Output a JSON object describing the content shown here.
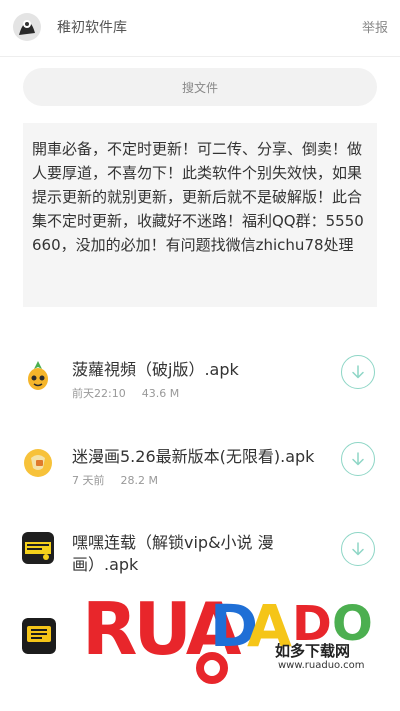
{
  "header": {
    "title": "稚初软件库",
    "report_label": "举报"
  },
  "search": {
    "placeholder": "搜文件"
  },
  "notice": {
    "text": "開車必备，不定时更新！可二传、分享、倒卖！做人要厚道，不喜勿下！此类软件个别失效快，如果提示更新的就别更新，更新后就不是破解版！此合集不定时更新，收藏好不迷路！福利QQ群：5550660，没加的必加！有问题找微信zhichu78处理"
  },
  "files": [
    {
      "name": "菠蘿視頻（破j版）.apk",
      "date": "前天22:10",
      "size": "43.6 M",
      "icon": "pineapple-icon"
    },
    {
      "name": "迷漫画5.26最新版本(无限看).apk",
      "date": "7 天前",
      "size": "28.2 M",
      "icon": "manga-icon"
    },
    {
      "name": "嘿嘿连载（解锁vip&小说 漫画）.apk",
      "date": "",
      "size": "",
      "icon": "comic-icon"
    },
    {
      "name": "",
      "date": "",
      "size": "",
      "icon": "app-icon"
    }
  ],
  "watermark": {
    "logo_text": "RUADADO",
    "cn_text": "如多下载网",
    "url_text": "www.ruaduo.com"
  },
  "colors": {
    "accent": "#8ed6c6",
    "watermark_red": "#e8262b",
    "watermark_blue": "#1f6fd6",
    "watermark_yellow": "#f5c518"
  }
}
